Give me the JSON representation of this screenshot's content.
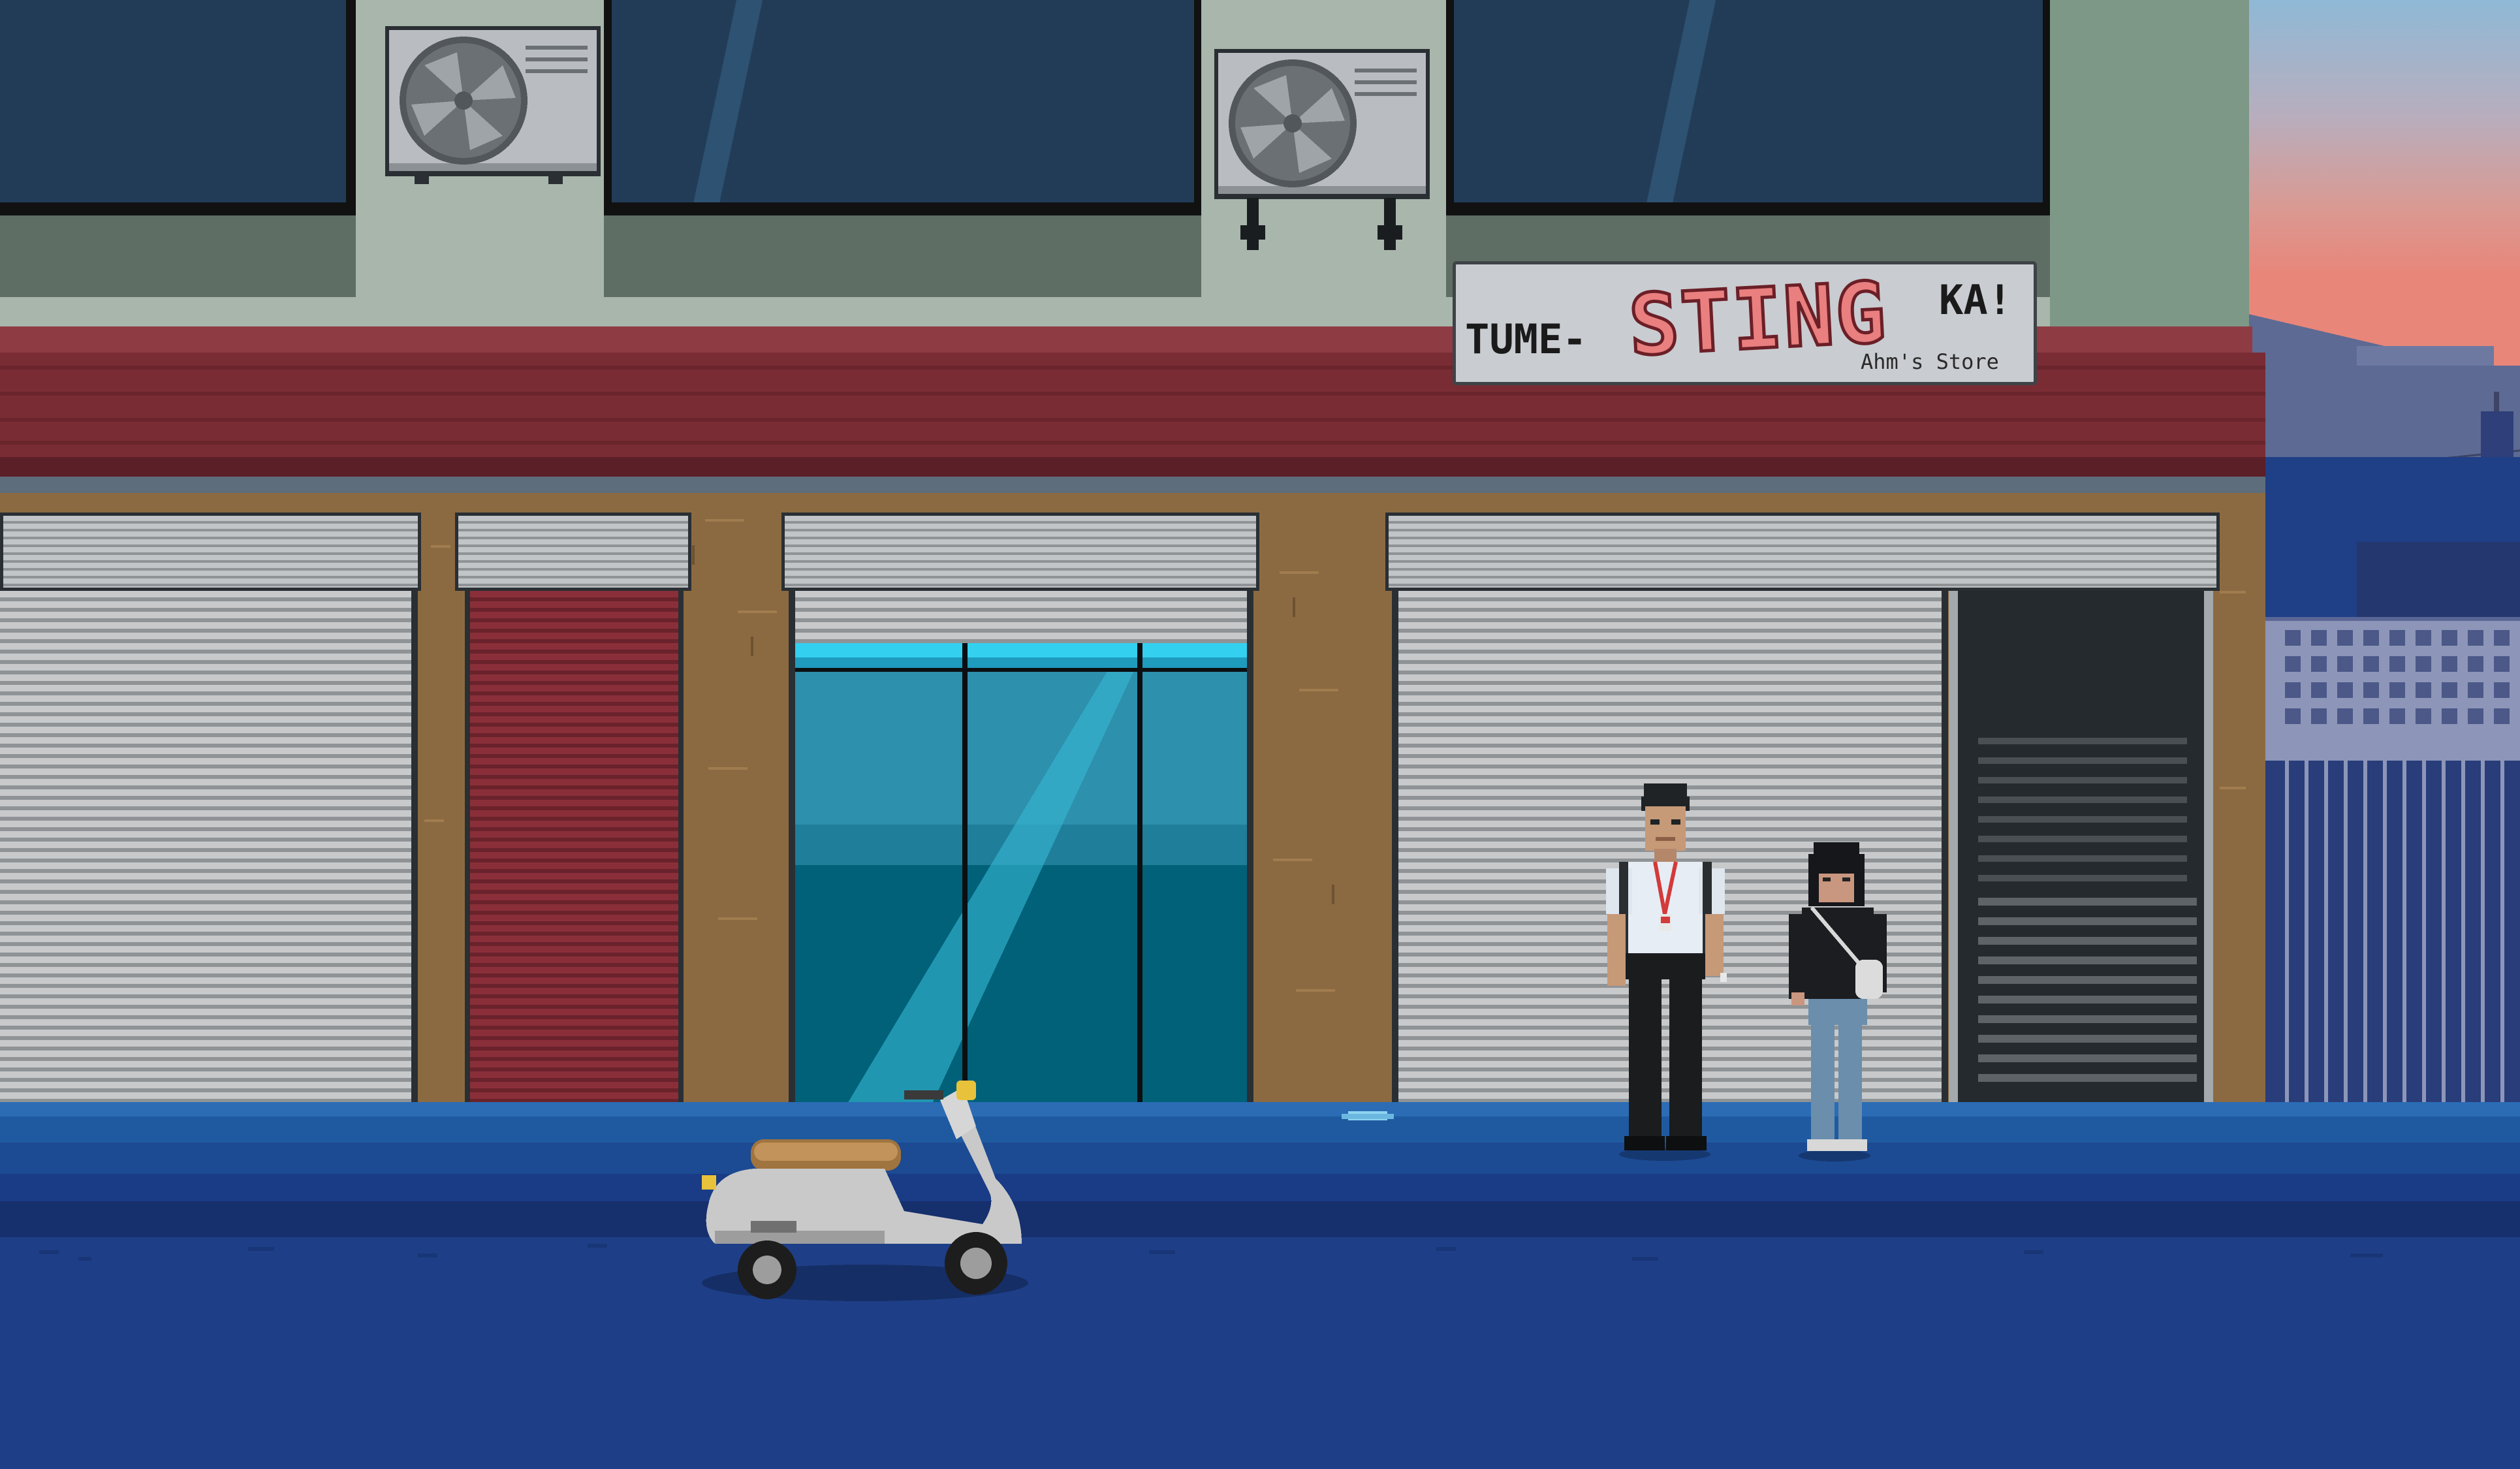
{
  "scene": {
    "sign": {
      "prefix": "TUME-",
      "main": "STING",
      "suffix": "KA!",
      "subtitle": "Ahm's Store"
    }
  },
  "colors": {
    "sky_top": "#8fb9d6",
    "sky_mid": "#c9a0a0",
    "sky_low": "#e8867a",
    "building_upper": "#a9b7ad",
    "building_shadow": "#5f6e65",
    "awning": "#7a2c34",
    "awning_dark": "#5b1f27",
    "shutter_light": "#c7c9cb",
    "shutter_dark": "#8f9396",
    "red_shutter": "#8a2f39",
    "brick": "#8c6a41",
    "glass": "#1e8aa3",
    "glass_dark": "#006178",
    "sidewalk": "#1f5aa0",
    "curb": "#1c3c84",
    "road": "#1e3f87",
    "sign_bg": "#c9ccd0",
    "sign_red": "#e97f7f",
    "gate": "#283d7a"
  }
}
